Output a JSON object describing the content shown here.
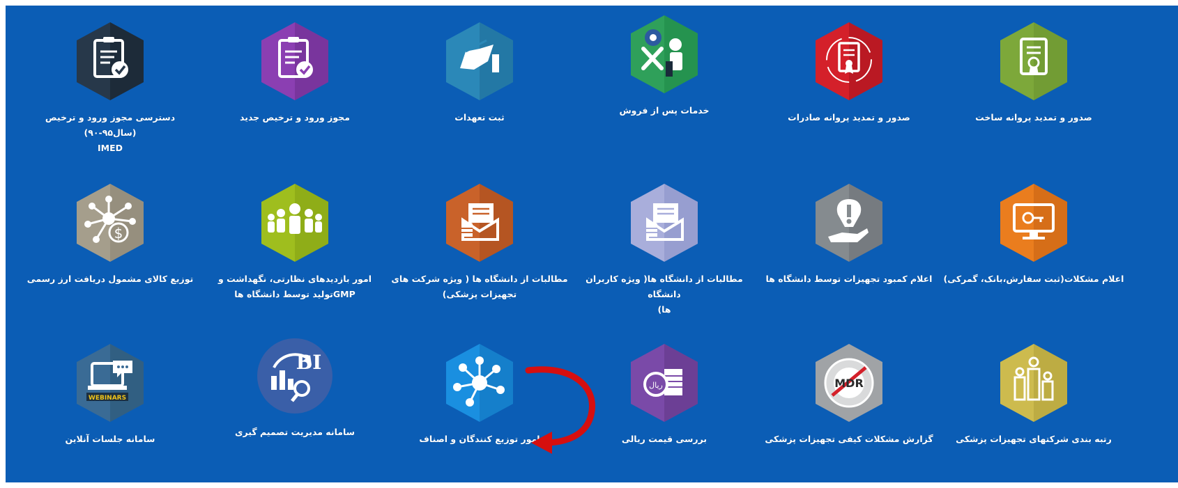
{
  "tiles": [
    {
      "row": 0,
      "col": 0,
      "label": "صدور و تمدید پروانه ساخت",
      "sub": "",
      "icon": "certificate-icon",
      "color": "#7da83a"
    },
    {
      "row": 0,
      "col": 1,
      "label": "صدور و تمدید پروانه صادرات",
      "sub": "",
      "icon": "certificate-ribbon-icon",
      "color": "#d4202a"
    },
    {
      "row": 0,
      "col": 2,
      "label": "خدمات پس از فروش",
      "sub": "",
      "icon": "repair-tools-icon",
      "color": "#2fa05a"
    },
    {
      "row": 0,
      "col": 3,
      "label": "ثبت تعهدات",
      "sub": "",
      "icon": "signing-hand-icon",
      "color": "#2b88b8"
    },
    {
      "row": 0,
      "col": 4,
      "label": "مجوز ورود و ترخیص جدید",
      "sub": "",
      "icon": "clipboard-check-icon",
      "color": "#8b3fb2"
    },
    {
      "row": 0,
      "col": 5,
      "label": "دسترسی مجوز ورود و ترخیص (سال۹۵-۹۰)",
      "sub": "IMED",
      "icon": "clipboard-check-icon",
      "color": "#27384a"
    },
    {
      "row": 1,
      "col": 0,
      "label": "اعلام مشکلات(ثبت سفارش،بانک، گمرکی)",
      "sub": "",
      "icon": "monitor-key-icon",
      "color": "#ea7d1e"
    },
    {
      "row": 1,
      "col": 1,
      "label": "اعلام کمبود تجهیزات توسط دانشگاه ها",
      "sub": "",
      "icon": "hand-alert-icon",
      "color": "#858b8f"
    },
    {
      "row": 1,
      "col": 2,
      "label": "مطالبات از دانشگاه ها( ویژه کاربران دانشگاه",
      "sub": "ها)",
      "icon": "envelope-coins-icon",
      "color": "#a9aedb"
    },
    {
      "row": 1,
      "col": 3,
      "label": "مطالبات از دانشگاه ها ( ویژه شرکت های",
      "sub": "تجهیزات پزشکی)",
      "icon": "envelope-coins-icon",
      "color": "#c9622a"
    },
    {
      "row": 1,
      "col": 4,
      "label": "امور بازدیدهای نظارتی، نگهداشت و",
      "sub": "GMPتولید توسط دانشگاه ها",
      "icon": "people-group-icon",
      "color": "#9fbe1e"
    },
    {
      "row": 1,
      "col": 5,
      "label": "توزیع کالای مشمول دریافت ارز رسمی",
      "sub": "",
      "icon": "network-dollar-icon",
      "color": "#a59e8c"
    },
    {
      "row": 2,
      "col": 0,
      "label": "رتبه بندی شرکتهای تجهیزات پزشکی",
      "sub": "",
      "icon": "ranking-people-icon",
      "color": "#cdbb4e"
    },
    {
      "row": 2,
      "col": 1,
      "label": "گزارش مشکلات کیفی تجهیزات پزشکی",
      "sub": "",
      "icon": "mdr-seal-icon",
      "color": "#a0a3a6"
    },
    {
      "row": 2,
      "col": 2,
      "label": "بررسی قیمت ریالی",
      "sub": "",
      "icon": "rial-coins-icon",
      "color": "#7a4aa8"
    },
    {
      "row": 2,
      "col": 3,
      "label": "امور توزیع کنندگان و اصناف",
      "sub": "",
      "icon": "network-nodes-icon",
      "color": "#1a8fe0"
    },
    {
      "row": 2,
      "col": 4,
      "label": "سامانه مدیریت تصمیم گیری",
      "sub": "",
      "icon": "bi-analytics-icon",
      "color": "#3a5fa8"
    },
    {
      "row": 2,
      "col": 5,
      "label": "سامانه جلسات آنلاین",
      "sub": "",
      "icon": "webinars-laptop-icon",
      "color": "#3a6b95"
    }
  ],
  "bi_text": "BI",
  "webinars_text": "WEBINARS",
  "mdr_text": "MDR",
  "rial_text": "ریال",
  "dollar_text": "$",
  "arrow_color": "#d60f0f"
}
